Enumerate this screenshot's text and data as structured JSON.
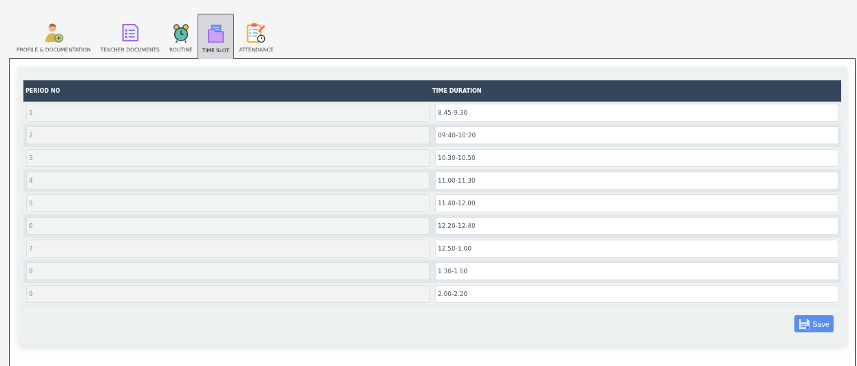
{
  "tabs": [
    {
      "label": "PROFILE & DOCUMENTATION",
      "kind": "profile",
      "selected": false
    },
    {
      "label": "TEACHER DOCUMENTS",
      "kind": "documents",
      "selected": false
    },
    {
      "label": "ROUTINE",
      "kind": "routine",
      "selected": false
    },
    {
      "label": "TIME SLOT",
      "kind": "timeslot",
      "selected": true
    },
    {
      "label": "ATTENDANCE",
      "kind": "attendance",
      "selected": false
    }
  ],
  "table": {
    "columns": [
      "PERIOD NO",
      "TIME DURATION"
    ],
    "rows": [
      {
        "period": "1",
        "duration": "8.45-9.30"
      },
      {
        "period": "2",
        "duration": "09:40-10:20"
      },
      {
        "period": "3",
        "duration": "10.30-10.50"
      },
      {
        "period": "4",
        "duration": "11.00-11.30"
      },
      {
        "period": "5",
        "duration": "11.40-12.00"
      },
      {
        "period": "6",
        "duration": "12.20-12.40"
      },
      {
        "period": "7",
        "duration": "12.50-1.00"
      },
      {
        "period": "8",
        "duration": "1.30-1.50"
      },
      {
        "period": "9",
        "duration": "2.00-2.20"
      }
    ]
  },
  "save_button": "Save"
}
